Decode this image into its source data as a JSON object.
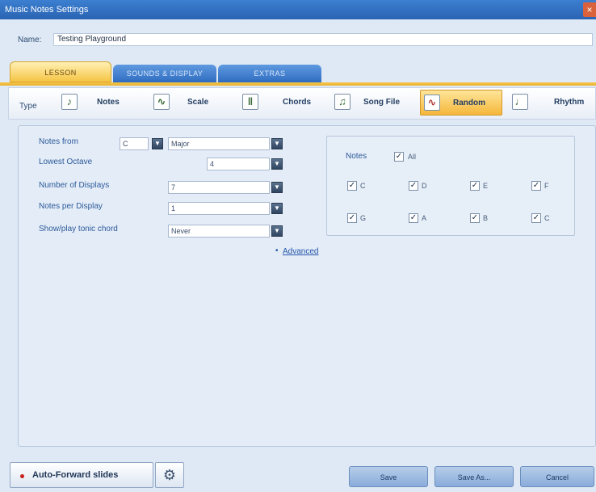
{
  "window": {
    "title": "Music Notes Settings",
    "close": "×"
  },
  "name_row": {
    "label": "Name:",
    "value": "Testing Playground"
  },
  "tabs": [
    {
      "label": "LESSON",
      "active": true
    },
    {
      "label": "SOUNDS & DISPLAY",
      "active": false
    },
    {
      "label": "EXTRAS",
      "active": false
    }
  ],
  "type_bar": {
    "label": "Type",
    "items": [
      {
        "label": "Notes",
        "icon": "♪",
        "active": false
      },
      {
        "label": "Scale",
        "icon": "∿",
        "active": false
      },
      {
        "label": "Chords",
        "icon": "‖",
        "active": false
      },
      {
        "label": "Song File",
        "icon": "♫",
        "active": false
      },
      {
        "label": "Random",
        "icon": "∿",
        "active": true
      },
      {
        "label": "Rhythm",
        "icon": "♩",
        "active": false
      }
    ]
  },
  "settings": {
    "notes_from_label": "Notes from",
    "notes_from_key": "C",
    "notes_from_mode": "Major",
    "lowest_octave_label": "Lowest Octave",
    "lowest_octave_value": "4",
    "num_displays_label": "Number of Displays",
    "num_displays_value": "7",
    "notes_per_display_label": "Notes per Display",
    "notes_per_display_value": "1",
    "tonic_chord_label": "Show/play tonic chord",
    "tonic_chord_value": "Never",
    "advanced_link": "Advanced"
  },
  "notes_box": {
    "label": "Notes",
    "all_label": "All",
    "notes": [
      "C",
      "D",
      "E",
      "F",
      "G",
      "A",
      "B",
      "C"
    ],
    "check_mark": "✓"
  },
  "bottom": {
    "auto_forward_label": "Auto-Forward slides",
    "save_label": "Save",
    "save_as_label": "Save As...",
    "cancel_label": "Cancel"
  }
}
